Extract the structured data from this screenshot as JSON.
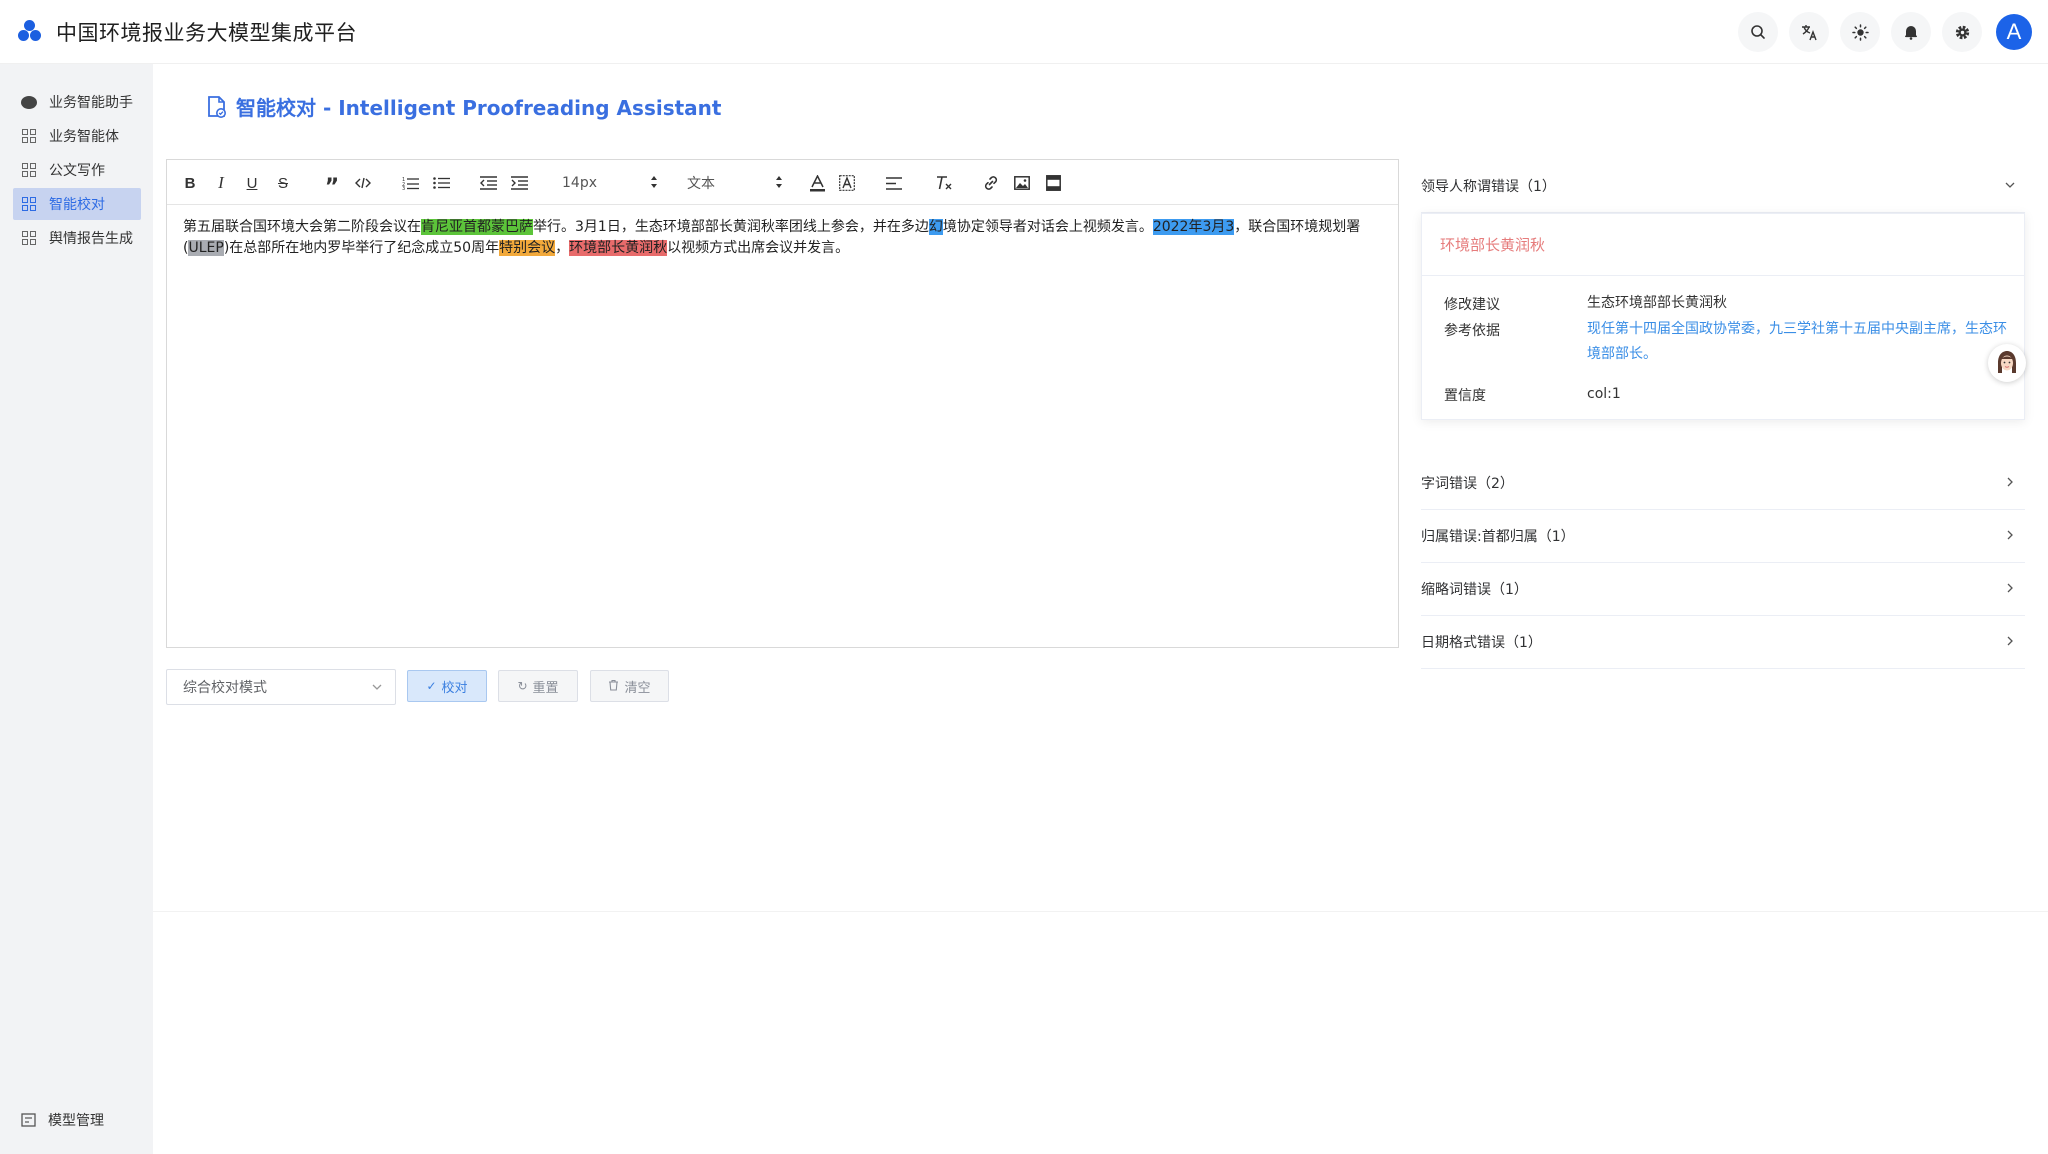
{
  "app": {
    "title": "中国环境报业务大模型集成平台",
    "avatar_letter": "A"
  },
  "sidebar": {
    "items": [
      {
        "label": "业务智能助手",
        "icon": "chat-bubble-icon",
        "active": false
      },
      {
        "label": "业务智能体",
        "icon": "grid-icon",
        "active": false
      },
      {
        "label": "公文写作",
        "icon": "grid-icon",
        "active": false
      },
      {
        "label": "智能校对",
        "icon": "grid-icon",
        "active": true
      },
      {
        "label": "舆情报告生成",
        "icon": "grid-icon",
        "active": false
      }
    ],
    "bottom_item": {
      "label": "模型管理",
      "icon": "model-icon"
    }
  },
  "main": {
    "page_title": "智能校对 - Intelligent Proofreading Assistant",
    "toolbar": {
      "font_size": "14px",
      "block_type": "文本"
    },
    "content": {
      "segments": [
        {
          "text": "第五届联合国环境大会第二阶段会议在",
          "hl": ""
        },
        {
          "text": "肯尼亚首都蒙巴萨",
          "hl": "green"
        },
        {
          "text": "举行。3月1日，生态环境部部长黄润秋率团线上参会，并在多边",
          "hl": ""
        },
        {
          "text": "幻",
          "hl": "blue"
        },
        {
          "text": "境协定领导者对话会上视频发言。",
          "hl": ""
        },
        {
          "text": "2022年3月3",
          "hl": "blue"
        },
        {
          "text": "，联合国环境规划署(",
          "hl": ""
        },
        {
          "text": "ULEP",
          "hl": "grey"
        },
        {
          "text": ")在总部所在地内罗毕举行了纪念成立50周年",
          "hl": ""
        },
        {
          "text": "特别会议",
          "hl": "orange"
        },
        {
          "text": "，",
          "hl": ""
        },
        {
          "text": "环境部长黄润秋",
          "hl": "red"
        },
        {
          "text": "以视频方式出席会议并发言。",
          "hl": ""
        }
      ]
    },
    "controls": {
      "mode": "综合校对模式",
      "proofread_label": "校对",
      "reset_label": "重置",
      "clear_label": "清空"
    }
  },
  "panel": {
    "expanded": {
      "title": "领导人称谓错误（1）",
      "error_text": "环境部长黄润秋",
      "suggestion_label": "修改建议",
      "suggestion_value": "生态环境部部长黄润秋",
      "basis_label": "参考依据",
      "basis_value": "现任第十四届全国政协常委，九三学社第十五届中央副主席，生态环境部部长。",
      "confidence_label": "置信度",
      "confidence_value": "col:1"
    },
    "collapsed": [
      {
        "title": "字词错误（2）"
      },
      {
        "title": "归属错误:首都归属（1）"
      },
      {
        "title": "缩略词错误（1）"
      },
      {
        "title": "日期格式错误（1）"
      }
    ]
  },
  "colors": {
    "accent": "#3a6fe0",
    "highlight_green": "#5cc43a",
    "highlight_blue": "#3d9bf0",
    "highlight_grey": "#a9acb2",
    "highlight_orange": "#f2a93b",
    "highlight_red": "#e86b6b"
  }
}
